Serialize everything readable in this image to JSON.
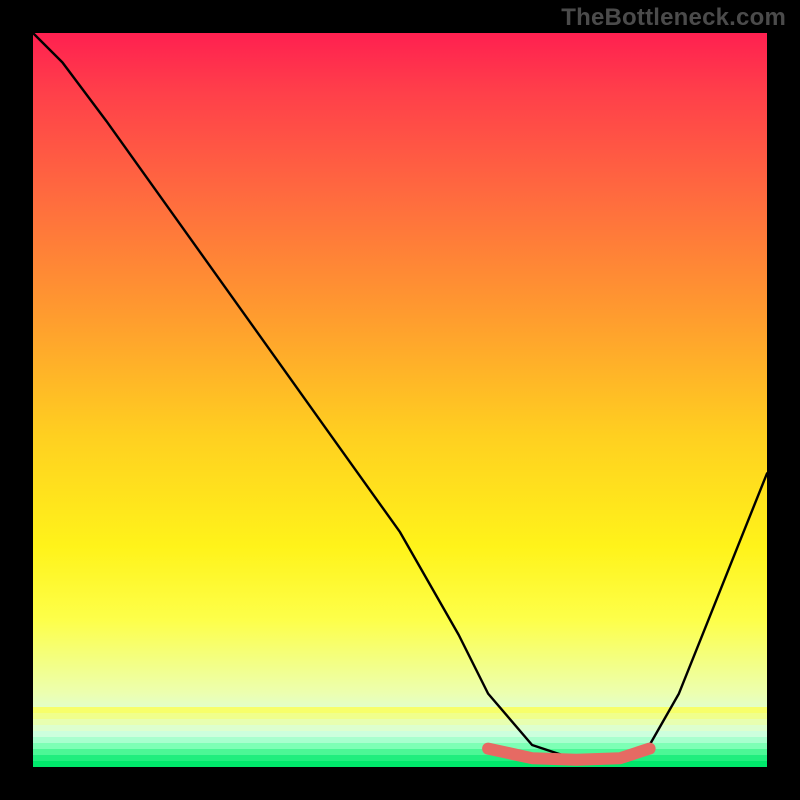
{
  "watermark": "TheBottleneck.com",
  "colors": {
    "frame": "#000000",
    "curve": "#000000",
    "accent": "#e66a63",
    "watermark": "#4b4b4b"
  },
  "chart_data": {
    "type": "line",
    "title": "",
    "xlabel": "",
    "ylabel": "",
    "xlim": [
      0,
      100
    ],
    "ylim": [
      0,
      100
    ],
    "grid": false,
    "series": [
      {
        "name": "curve",
        "x": [
          0,
          4,
          10,
          20,
          30,
          40,
          50,
          58,
          62,
          68,
          74,
          80,
          84,
          88,
          92,
          96,
          100
        ],
        "y": [
          100,
          96,
          88,
          74,
          60,
          46,
          32,
          18,
          10,
          3,
          1,
          1,
          3,
          10,
          20,
          30,
          40
        ]
      },
      {
        "name": "highlight-flat",
        "x": [
          62,
          68,
          74,
          80,
          84
        ],
        "y": [
          2.5,
          1.2,
          1,
          1.2,
          2.5
        ]
      }
    ],
    "annotations": []
  }
}
